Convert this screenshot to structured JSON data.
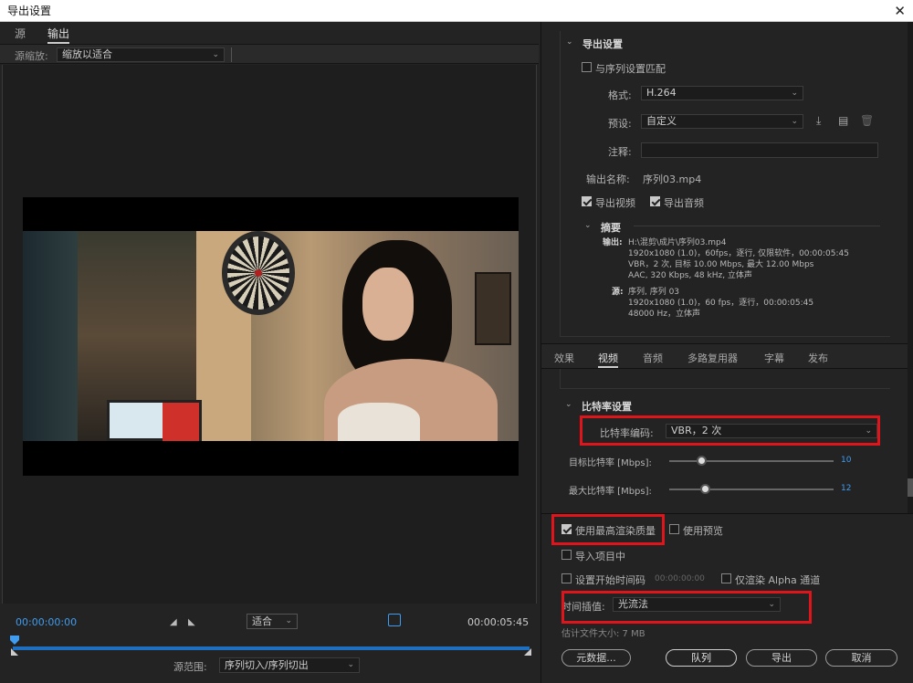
{
  "window": {
    "title": "导出设置",
    "close_glyph": "✕"
  },
  "left_tabs": [
    {
      "label": "源"
    },
    {
      "label": "输出"
    }
  ],
  "source_scale": {
    "label": "源缩放:",
    "value": "缩放以适合"
  },
  "timeline": {
    "current": "00:00:00:00",
    "end": "00:00:05:45",
    "fit": "适合"
  },
  "source_range": {
    "label": "源范围:",
    "value": "序列切入/序列切出"
  },
  "export_settings": {
    "header": "导出设置",
    "match_sequence": "与序列设置匹配",
    "format_label": "格式:",
    "format_value": "H.264",
    "preset_label": "预设:",
    "preset_value": "自定义",
    "comment_label": "注释:",
    "output_name_label": "输出名称:",
    "output_name_value": "序列03.mp4",
    "export_video": "导出视频",
    "export_audio": "导出音频"
  },
  "summary": {
    "header": "摘要",
    "output_label": "输出:",
    "output_lines": [
      "H:\\混剪\\成片\\序列03.mp4",
      "1920x1080 (1.0)，60fps，逐行, 仅限软件，00:00:05:45",
      "VBR，2 次, 目标 10.00 Mbps, 最大 12.00 Mbps",
      "AAC, 320 Kbps, 48  kHz, 立体声"
    ],
    "source_label": "源:",
    "source_lines": [
      "序列, 序列 03",
      "1920x1080 (1.0)，60 fps，逐行，00:00:05:45",
      "48000 Hz，立体声"
    ]
  },
  "sub_tabs": [
    {
      "label": "效果"
    },
    {
      "label": "视频"
    },
    {
      "label": "音频"
    },
    {
      "label": "多路复用器"
    },
    {
      "label": "字幕"
    },
    {
      "label": "发布"
    }
  ],
  "bitrate": {
    "header": "比特率设置",
    "encoding_label": "比特率编码:",
    "encoding_value": "VBR，2 次",
    "target_label": "目标比特率 [Mbps]:",
    "target_value": "10",
    "target_fraction": 0.2,
    "max_label": "最大比特率 [Mbps]:",
    "max_value": "12",
    "max_fraction": 0.22
  },
  "options": {
    "max_render": "使用最高渲染质量",
    "use_preview": "使用预览",
    "import_project": "导入项目中",
    "start_timecode": "设置开始时间码",
    "start_timecode_value": "00:00:00:00",
    "alpha_only": "仅渲染 Alpha 通道",
    "interp_label": "时间插值:",
    "interp_value": "光流法",
    "file_size": "估计文件大小: 7 MB"
  },
  "buttons": {
    "metadata": "元数据...",
    "queue": "队列",
    "export": "导出",
    "cancel": "取消"
  },
  "colors": {
    "accent": "#3f9cf0",
    "highlight": "#e0141b"
  }
}
